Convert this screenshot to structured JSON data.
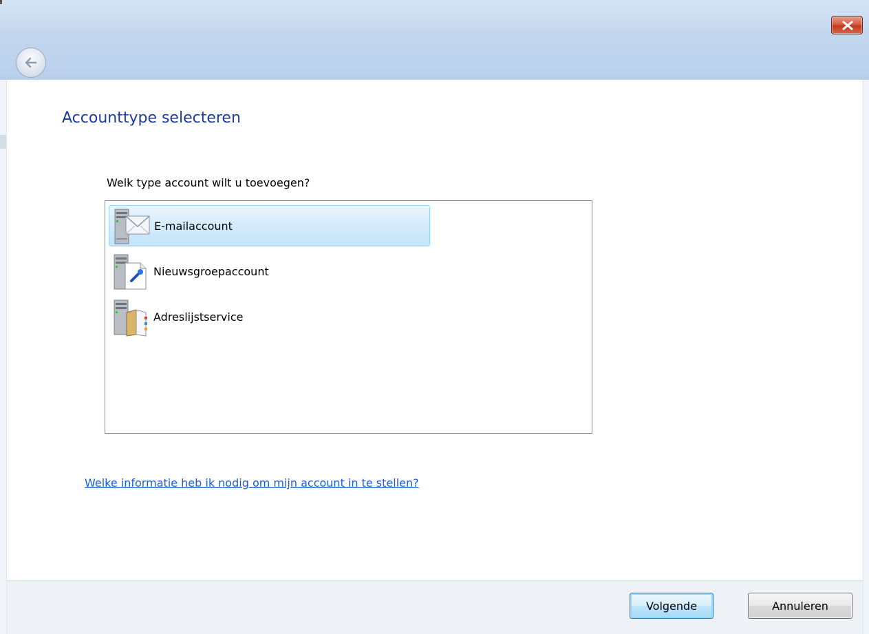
{
  "window": {
    "close_icon": "close-x-icon",
    "back_icon": "back-arrow-icon"
  },
  "page": {
    "heading": "Accounttype selecteren",
    "question": "Welk type account wilt u toevoegen?",
    "account_types": [
      {
        "label": "E-mailaccount",
        "icon": "email-server-icon",
        "selected": true
      },
      {
        "label": "Nieuwsgroepaccount",
        "icon": "newsgroup-server-icon",
        "selected": false
      },
      {
        "label": "Adreslijstservice",
        "icon": "directory-server-icon",
        "selected": false
      }
    ],
    "help_link": "Welke informatie heb ik nodig om mijn account in te stellen?"
  },
  "footer": {
    "next_label": "Volgende",
    "cancel_label": "Annuleren"
  },
  "colors": {
    "heading": "#1e3d9a",
    "link": "#1a5fd4",
    "selection": "#c5e3f8",
    "close_button": "#c2391d"
  }
}
